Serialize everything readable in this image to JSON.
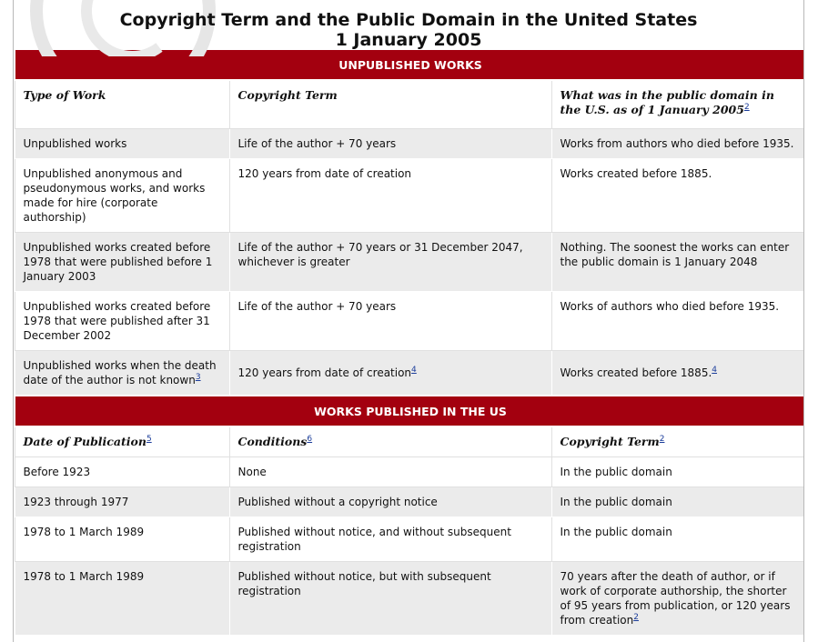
{
  "title": {
    "line1": "Copyright Term and the Public Domain in the United States",
    "line2": "1 January 2005"
  },
  "sections": {
    "unpublished": {
      "heading": "UNPUBLISHED WORKS",
      "headers": {
        "col1": "Type of Work",
        "col2": "Copyright Term",
        "col3": "What was in the public domain in the U.S. as of 1 January 2005",
        "col3_fn": "2"
      },
      "rows": [
        {
          "c1": "Unpublished works",
          "c2": "Life of the author + 70 years",
          "c3": "Works from authors who died before 1935."
        },
        {
          "c1": "Unpublished anonymous and pseudonymous works, and works made for hire (corporate authorship)",
          "c2": "120 years from date of creation",
          "c3": "Works created before 1885."
        },
        {
          "c1": "Unpublished works created before 1978 that were published before 1 January 2003",
          "c2": "Life of the author + 70 years or 31 December 2047, whichever is greater",
          "c3": "Nothing. The soonest the works can enter the public domain is 1 January 2048"
        },
        {
          "c1": "Unpublished works created before 1978 that were published after 31 December 2002",
          "c2": "Life of the author + 70 years",
          "c3": "Works of authors who died before 1935."
        },
        {
          "c1": "Unpublished works when the death date of the author is not known",
          "c1_fn": "3",
          "c2": "120 years from date of creation",
          "c2_fn": "4",
          "c3": "Works created before 1885.",
          "c3_fn": "4"
        }
      ]
    },
    "published": {
      "heading": "WORKS PUBLISHED IN THE US",
      "headers": {
        "col1": "Date of Publication",
        "col1_fn": "5",
        "col2": "Conditions",
        "col2_fn": "6",
        "col3": "Copyright Term",
        "col3_fn": "2"
      },
      "rows": [
        {
          "c1": "Before 1923",
          "c2": "None",
          "c3": "In the public domain"
        },
        {
          "c1": "1923 through 1977",
          "c2": "Published without a copyright notice",
          "c3": "In the public domain"
        },
        {
          "c1": "1978 to 1 March 1989",
          "c2": "Published without notice, and without subsequent registration",
          "c3": "In the public domain"
        },
        {
          "c1": "1978 to 1 March 1989",
          "c2": "Published without notice, but with subsequent registration",
          "c3": "70 years after the death of author, or if work of corporate authorship, the shorter of 95 years from publication, or 120 years from creation",
          "c3_fn": "2"
        }
      ]
    }
  },
  "colors": {
    "section_bg": "#a3000f",
    "row_grey": "#ebebeb",
    "link": "#1a3c9a"
  },
  "icons": {
    "watermark": "copyright-symbol-watermark"
  }
}
